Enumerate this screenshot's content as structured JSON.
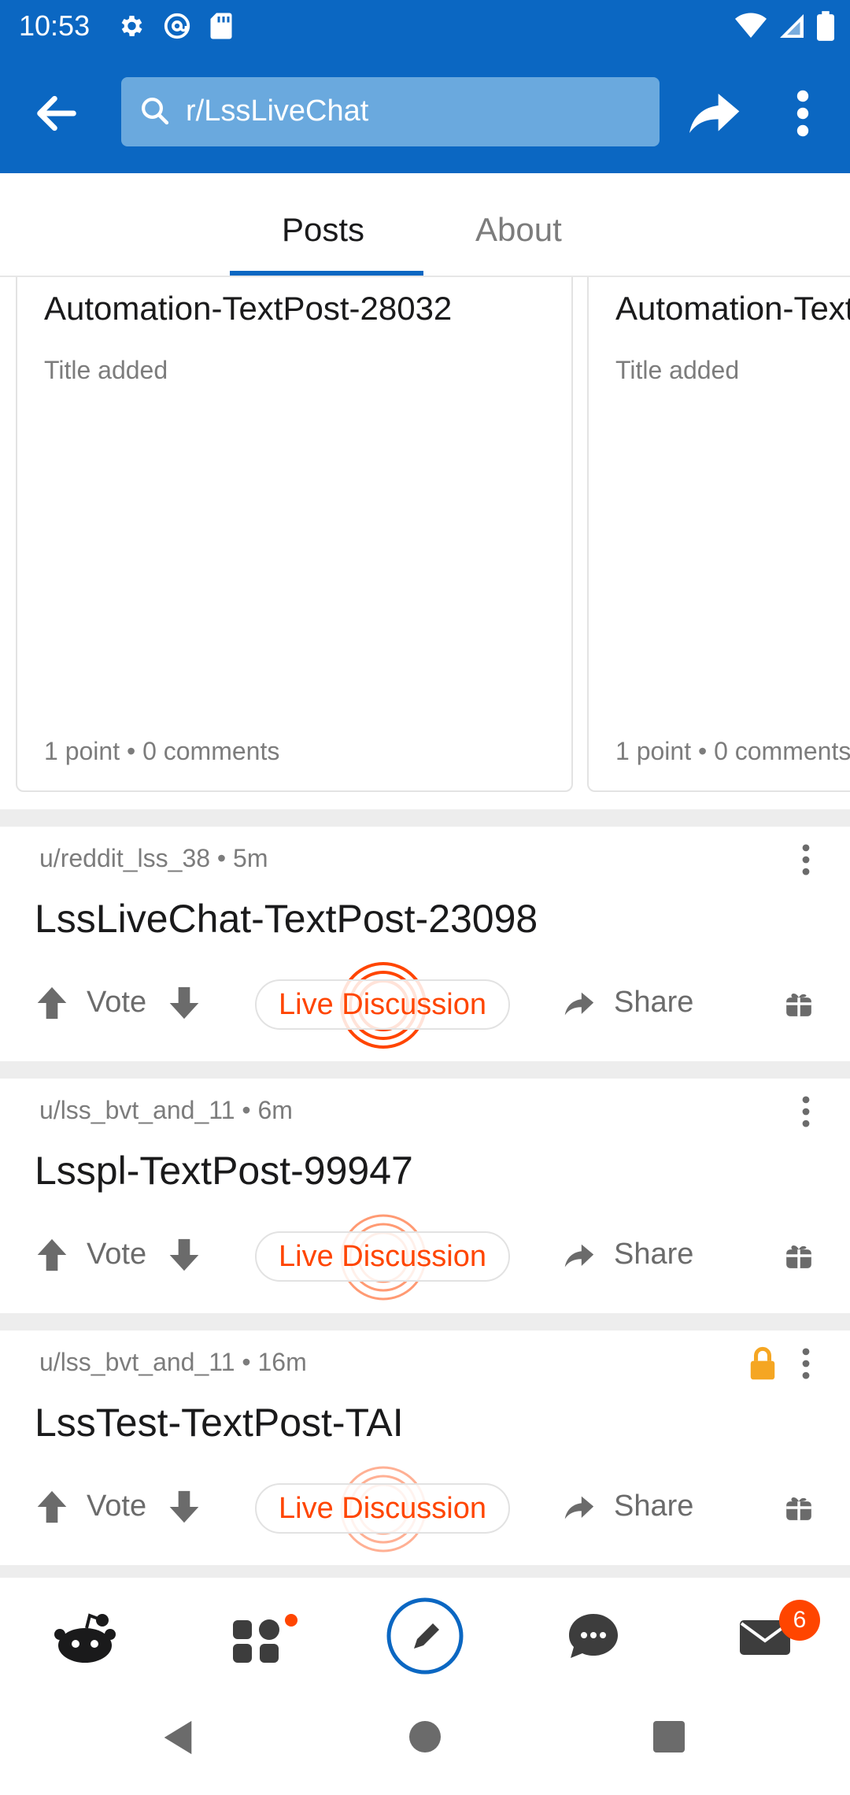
{
  "status_bar": {
    "time": "10:53",
    "icons": [
      "settings-icon",
      "at-sign-icon",
      "sd-card-icon",
      "wifi-icon",
      "signal-icon",
      "battery-icon"
    ]
  },
  "app_bar": {
    "search_text": "r/LssLiveChat",
    "icons": [
      "back-arrow-icon",
      "search-icon",
      "share-icon",
      "more-vert-icon"
    ]
  },
  "tabs": [
    {
      "label": "Posts",
      "active": true
    },
    {
      "label": "About",
      "active": false
    }
  ],
  "carousel": [
    {
      "title": "Automation-TextPost-28032",
      "body": "Title added",
      "footer": "1 point • 0 comments"
    },
    {
      "title": "Automation-TextPost",
      "body": "Title added",
      "footer": "1 point • 0 comments"
    }
  ],
  "posts": [
    {
      "meta": "u/reddit_lss_38 • 5m",
      "title": "LssLiveChat-TextPost-23098",
      "vote_label": "Vote",
      "live_label": "Live Discussion",
      "share_label": "Share",
      "locked": false
    },
    {
      "meta": "u/lss_bvt_and_11 • 6m",
      "title": "Lsspl-TextPost-99947",
      "vote_label": "Vote",
      "live_label": "Live Discussion",
      "share_label": "Share",
      "locked": false
    },
    {
      "meta": "u/lss_bvt_and_11 • 16m",
      "title": "LssTest-TextPost-TAI",
      "vote_label": "Vote",
      "live_label": "Live Discussion",
      "share_label": "Share",
      "locked": true
    }
  ],
  "bottom_nav": {
    "items": [
      "home-icon",
      "communities-icon",
      "create-post-icon",
      "chat-icon",
      "inbox-icon"
    ],
    "inbox_badge": "6"
  },
  "colors": {
    "brand_blue": "#0b67c2",
    "search_bg": "#6aa9de",
    "accent_orange": "#ff4500",
    "lock_yellow": "#f5a623"
  }
}
